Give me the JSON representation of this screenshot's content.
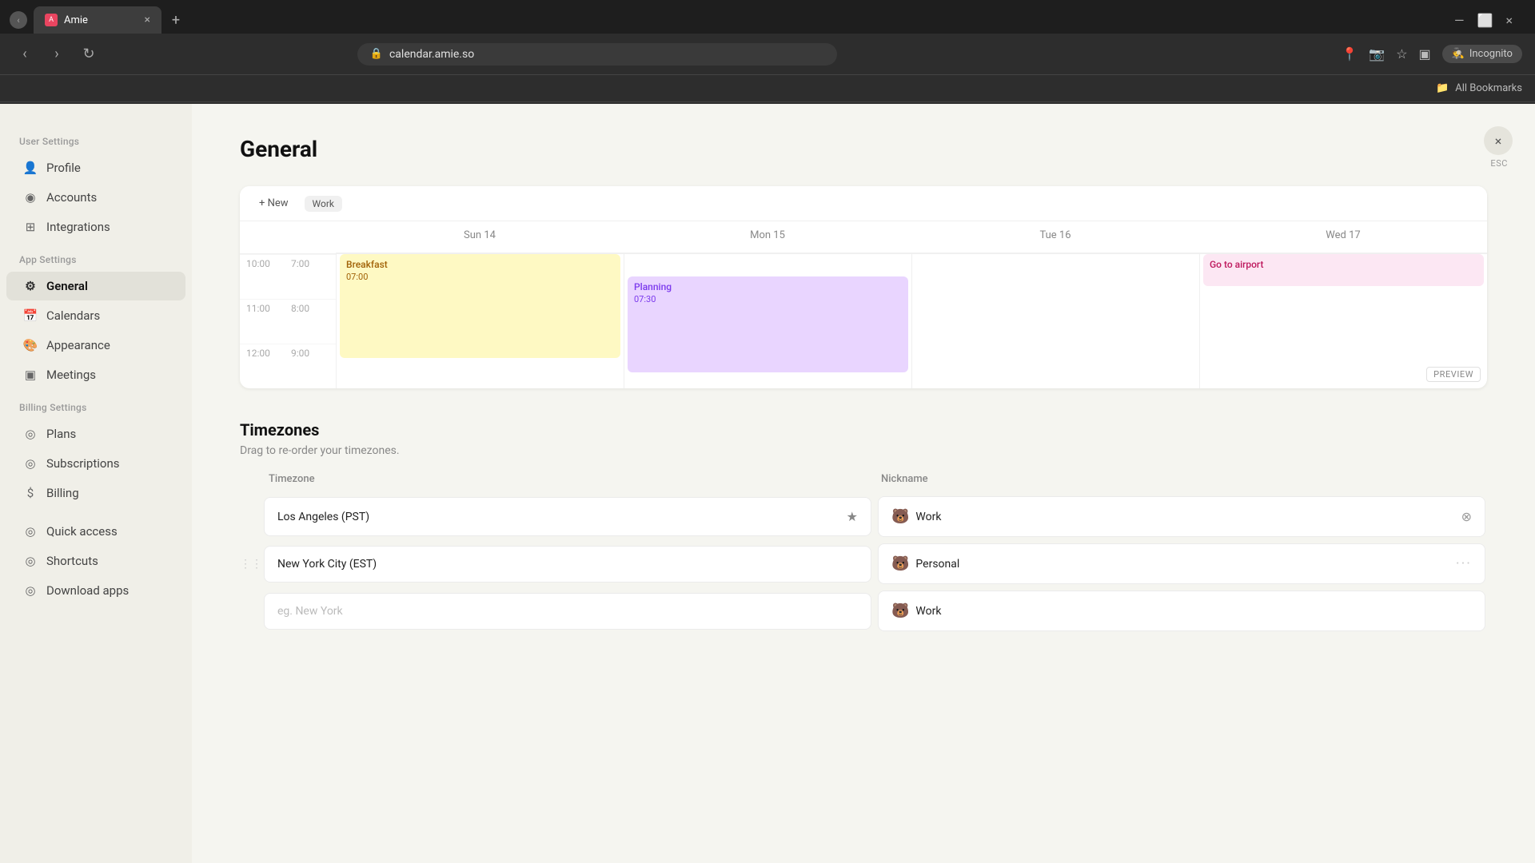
{
  "browser": {
    "tab_favicon": "A",
    "tab_title": "Amie",
    "tab_close": "×",
    "tab_new": "+",
    "url": "calendar.amie.so",
    "window_min": "—",
    "window_max": "⬜",
    "window_close": "×",
    "back_icon": "‹",
    "forward_icon": "›",
    "reload_icon": "↻",
    "lock_icon": "🔒",
    "incognito_label": "Incognito",
    "bookmarks_label": "All Bookmarks"
  },
  "sidebar": {
    "user_settings_label": "User Settings",
    "app_settings_label": "App Settings",
    "billing_settings_label": "Billing Settings",
    "items_user": [
      {
        "id": "profile",
        "label": "Profile",
        "icon": "👤"
      },
      {
        "id": "accounts",
        "label": "Accounts",
        "icon": "◉"
      },
      {
        "id": "integrations",
        "label": "Integrations",
        "icon": "⊞"
      }
    ],
    "items_app": [
      {
        "id": "general",
        "label": "General",
        "icon": "⚙",
        "active": true
      },
      {
        "id": "calendars",
        "label": "Calendars",
        "icon": "📅"
      },
      {
        "id": "appearance",
        "label": "Appearance",
        "icon": "🎨"
      },
      {
        "id": "meetings",
        "label": "Meetings",
        "icon": "▣"
      }
    ],
    "items_billing": [
      {
        "id": "plans",
        "label": "Plans",
        "icon": "◎"
      },
      {
        "id": "subscriptions",
        "label": "Subscriptions",
        "icon": "◎"
      },
      {
        "id": "billing",
        "label": "Billing",
        "icon": "$"
      }
    ],
    "items_other": [
      {
        "id": "quick-access",
        "label": "Quick access",
        "icon": "◎"
      },
      {
        "id": "shortcuts",
        "label": "Shortcuts",
        "icon": "◎"
      },
      {
        "id": "download-apps",
        "label": "Download apps",
        "icon": "◎"
      }
    ]
  },
  "main": {
    "title": "General",
    "close_btn": "×",
    "esc_label": "ESC",
    "calendar_preview": {
      "new_label": "+ New",
      "work_label": "Work",
      "days": [
        "Sun 14",
        "Mon 15",
        "Tue 16",
        "Wed 17"
      ],
      "times_left": [
        "10:00",
        "11:00",
        "12:00"
      ],
      "times_right": [
        "7:00",
        "8:00",
        "9:00"
      ],
      "events": [
        {
          "id": "breakfast",
          "title": "Breakfast",
          "time": "07:00",
          "day": 0
        },
        {
          "id": "planning",
          "title": "Planning",
          "time": "07:30",
          "day": 1
        },
        {
          "id": "airport",
          "title": "Go to airport",
          "time": "",
          "day": 3
        }
      ],
      "preview_label": "PREVIEW"
    },
    "timezones": {
      "title": "Timezones",
      "subtitle": "Drag to re-order your timezones.",
      "col_timezone": "Timezone",
      "col_nickname": "Nickname",
      "rows": [
        {
          "timezone": "Los Angeles (PST)",
          "nickname": "Work",
          "nickname_emoji": "🐻",
          "has_star": true,
          "has_close": true,
          "drag": false
        },
        {
          "timezone": "New York City (EST)",
          "nickname": "Personal",
          "nickname_emoji": "🐻",
          "has_star": false,
          "has_close": false,
          "has_dots": true,
          "drag": true
        },
        {
          "timezone": "eg. New York",
          "nickname": "Work",
          "nickname_emoji": "🐻",
          "muted_tz": true,
          "has_star": false,
          "has_close": false,
          "drag": false
        }
      ]
    }
  }
}
